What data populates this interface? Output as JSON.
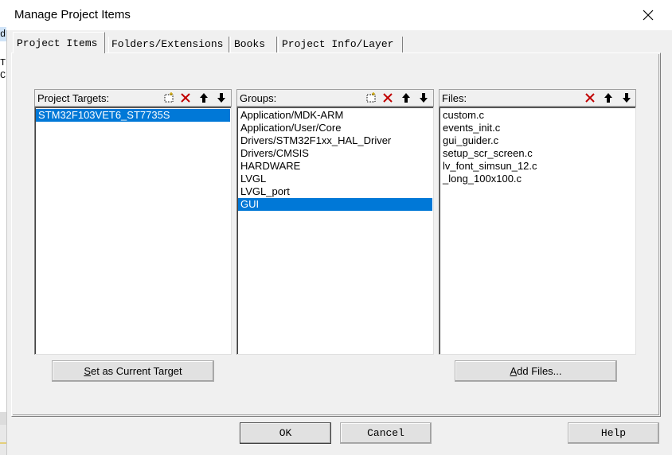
{
  "background": {
    "code_lines": [
      "d",
      "T",
      "C"
    ]
  },
  "dialog": {
    "title": "Manage Project Items"
  },
  "tabs": [
    {
      "label": "Project Items",
      "active": true
    },
    {
      "label": "Folders/Extensions",
      "active": false
    },
    {
      "label": "Books",
      "active": false
    },
    {
      "label": "Project Info/Layer",
      "active": false
    }
  ],
  "targets": {
    "header": "Project Targets:",
    "items": [
      "STM32F103VET6_ST7735S"
    ],
    "selected_index": 0,
    "set_target_button": {
      "accel": "S",
      "rest": "et as Current Target"
    }
  },
  "groups": {
    "header": "Groups:",
    "items": [
      "Application/MDK-ARM",
      "Application/User/Core",
      "Drivers/STM32F1xx_HAL_Driver",
      "Drivers/CMSIS",
      "HARDWARE",
      "LVGL",
      "LVGL_port",
      "GUI"
    ],
    "selected_index": 7
  },
  "files": {
    "header": "Files:",
    "items": [
      "custom.c",
      "events_init.c",
      "gui_guider.c",
      "setup_scr_screen.c",
      "lv_font_simsun_12.c",
      "_long_100x100.c"
    ],
    "add_files_button": {
      "accel": "A",
      "rest": "dd Files..."
    }
  },
  "footer": {
    "ok_label": "OK",
    "cancel_label": "Cancel",
    "help_label": "Help"
  },
  "colors": {
    "selection": "#0078d7",
    "delete_icon": "#c00000"
  }
}
